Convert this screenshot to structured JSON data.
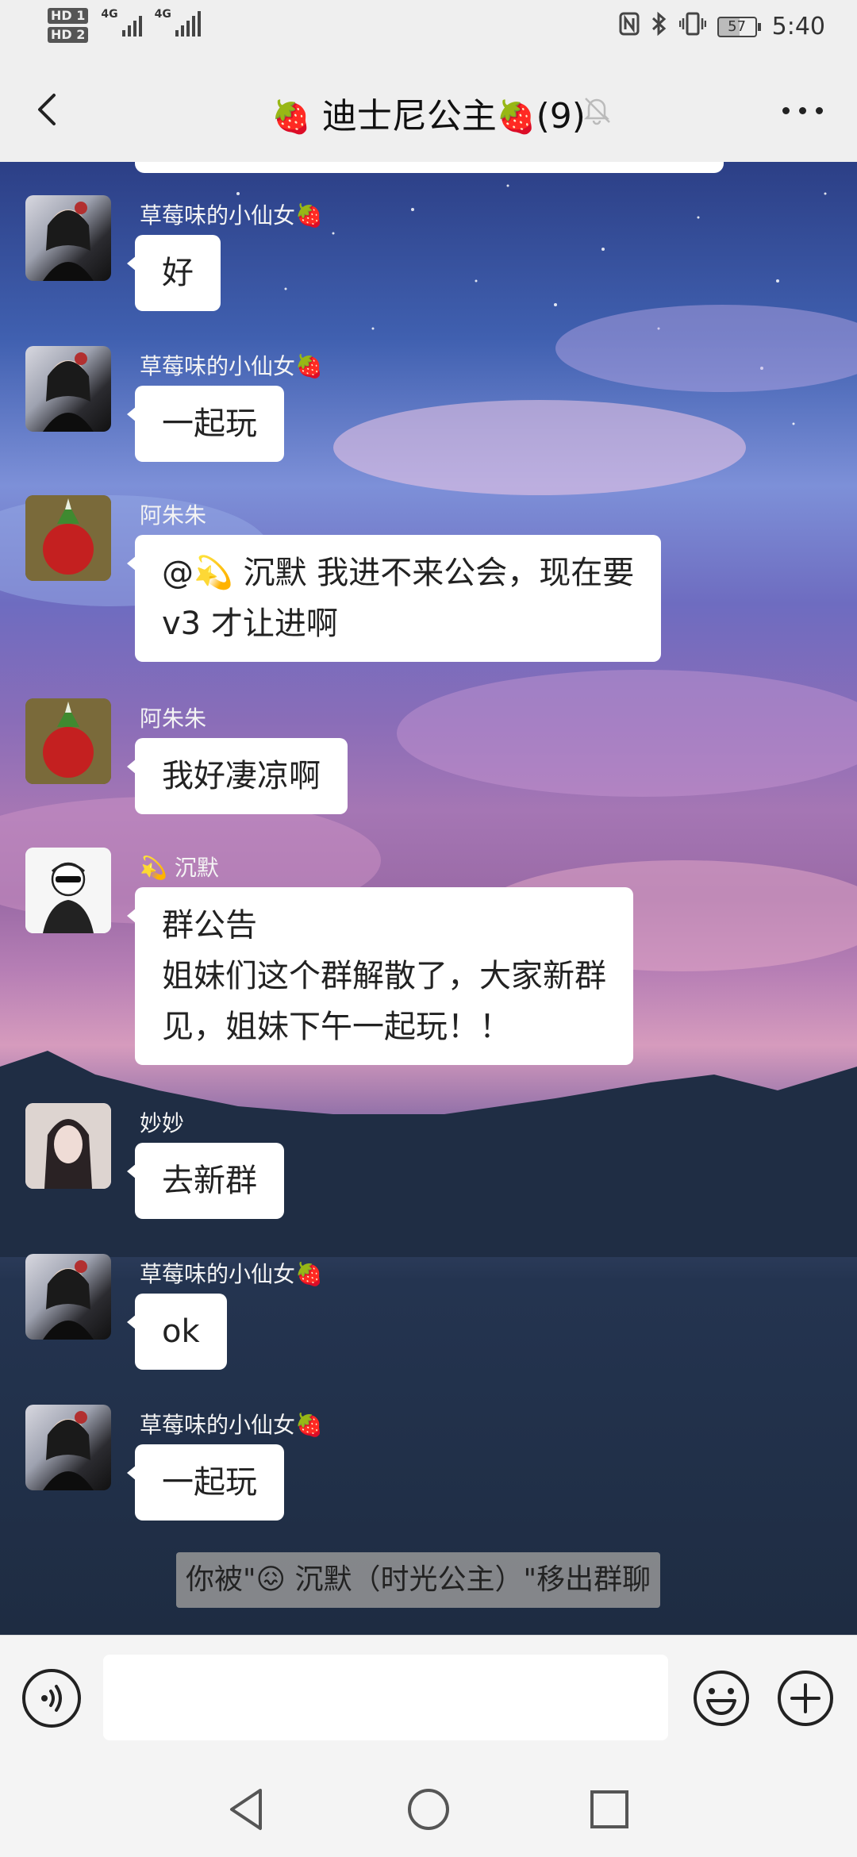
{
  "status_bar": {
    "hd1": "HD 1",
    "hd2": "HD 2",
    "net1": "4G",
    "net2": "4G",
    "battery": "57",
    "time": "5:40",
    "icons": [
      "nfc-icon",
      "bluetooth-icon",
      "vibrate-icon",
      "battery-icon"
    ]
  },
  "header": {
    "title_prefix": "🍓",
    "title": "迪士尼公主",
    "title_suffix": "🍓",
    "member_count": "(9)"
  },
  "messages": [
    {
      "sender": "草莓味的小仙女🍓",
      "lines": [
        "好"
      ],
      "avatar": "girl-photo"
    },
    {
      "sender": "草莓味的小仙女🍓",
      "lines": [
        "一起玩"
      ],
      "avatar": "girl-photo"
    },
    {
      "sender": "阿朱朱",
      "lines": [
        "@💫 沉默  我进不来公会，现在要",
        "v3 才让进啊"
      ],
      "avatar": "red-radish"
    },
    {
      "sender": "阿朱朱",
      "lines": [
        "我好凄凉啊"
      ],
      "avatar": "red-radish"
    },
    {
      "sender": "💫 沉默",
      "lines": [
        "群公告",
        "姐妹们这个群解散了，大家新群",
        "见，姐妹下午一起玩！！"
      ],
      "avatar": "cartoon-boy"
    },
    {
      "sender": "妙妙",
      "lines": [
        "去新群"
      ],
      "avatar": "girl-portrait"
    },
    {
      "sender": "草莓味的小仙女🍓",
      "lines": [
        "ok"
      ],
      "avatar": "girl-photo"
    },
    {
      "sender": "草莓味的小仙女🍓",
      "lines": [
        "一起玩"
      ],
      "avatar": "girl-photo"
    }
  ],
  "system_notice": "你被\"😖 沉默（时光公主）\"移出群聊",
  "input": {
    "placeholder": "",
    "value": ""
  },
  "colors": {
    "bubble": "#ffffff",
    "sender_text": "#f4f4f4",
    "bar_bg": "#efefef"
  }
}
